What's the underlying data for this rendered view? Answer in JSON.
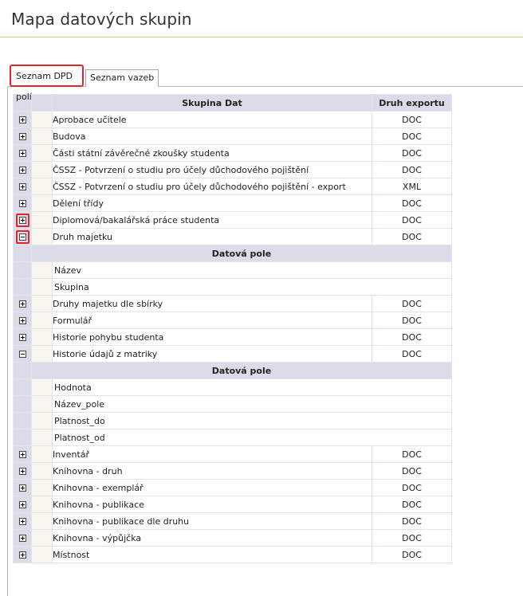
{
  "page": {
    "title": "Mapa datových skupin"
  },
  "tabs": [
    {
      "label": "Seznam DPD polí",
      "active": true
    },
    {
      "label": "Seznam vazeb",
      "active": false
    }
  ],
  "grid": {
    "columns": {
      "group": "Skupina Dat",
      "export": "Druh exportu"
    },
    "subheader": "Datová pole",
    "rows": [
      {
        "name": "Aprobace učitele",
        "export": "DOC",
        "state": "collapsed"
      },
      {
        "name": "Budova",
        "export": "DOC",
        "state": "collapsed"
      },
      {
        "name": "Části státní závěrečné zkoušky studenta",
        "export": "DOC",
        "state": "collapsed"
      },
      {
        "name": "ČSSZ - Potvrzení o studiu pro účely důchodového pojištění",
        "export": "DOC",
        "state": "collapsed"
      },
      {
        "name": "ČSSZ - Potvrzení o studiu pro účely důchodového pojištění - export",
        "export": "XML",
        "state": "collapsed"
      },
      {
        "name": "Dělení třídy",
        "export": "DOC",
        "state": "collapsed"
      },
      {
        "name": "Diplomová/bakalářská práce studenta",
        "export": "DOC",
        "state": "collapsed",
        "highlighted": true
      },
      {
        "name": "Druh majetku",
        "export": "DOC",
        "state": "expanded",
        "highlighted": true,
        "fields": [
          "Název",
          "Skupina"
        ]
      },
      {
        "name": "Druhy majetku dle sbírky",
        "export": "DOC",
        "state": "collapsed"
      },
      {
        "name": "Formulář",
        "export": "DOC",
        "state": "collapsed"
      },
      {
        "name": "Historie pohybu studenta",
        "export": "DOC",
        "state": "collapsed"
      },
      {
        "name": "Historie údajů z matriky",
        "export": "DOC",
        "state": "expanded",
        "fields": [
          "Hodnota",
          "Název_pole",
          "Platnost_do",
          "Platnost_od"
        ]
      },
      {
        "name": "Inventář",
        "export": "DOC",
        "state": "collapsed"
      },
      {
        "name": "Knihovna - druh",
        "export": "DOC",
        "state": "collapsed"
      },
      {
        "name": "Knihovna - exemplář",
        "export": "DOC",
        "state": "collapsed"
      },
      {
        "name": "Knihovna - publikace",
        "export": "DOC",
        "state": "collapsed"
      },
      {
        "name": "Knihovna - publikace dle druhu",
        "export": "DOC",
        "state": "collapsed"
      },
      {
        "name": "Knihovna - výpůjčka",
        "export": "DOC",
        "state": "collapsed"
      },
      {
        "name": "Místnost",
        "export": "DOC",
        "state": "collapsed"
      }
    ]
  },
  "icons": {
    "expand": "plus-box-icon",
    "collapse": "minus-box-icon"
  },
  "colors": {
    "highlight": "#e0262c",
    "header_bg": "#dcdce8"
  }
}
